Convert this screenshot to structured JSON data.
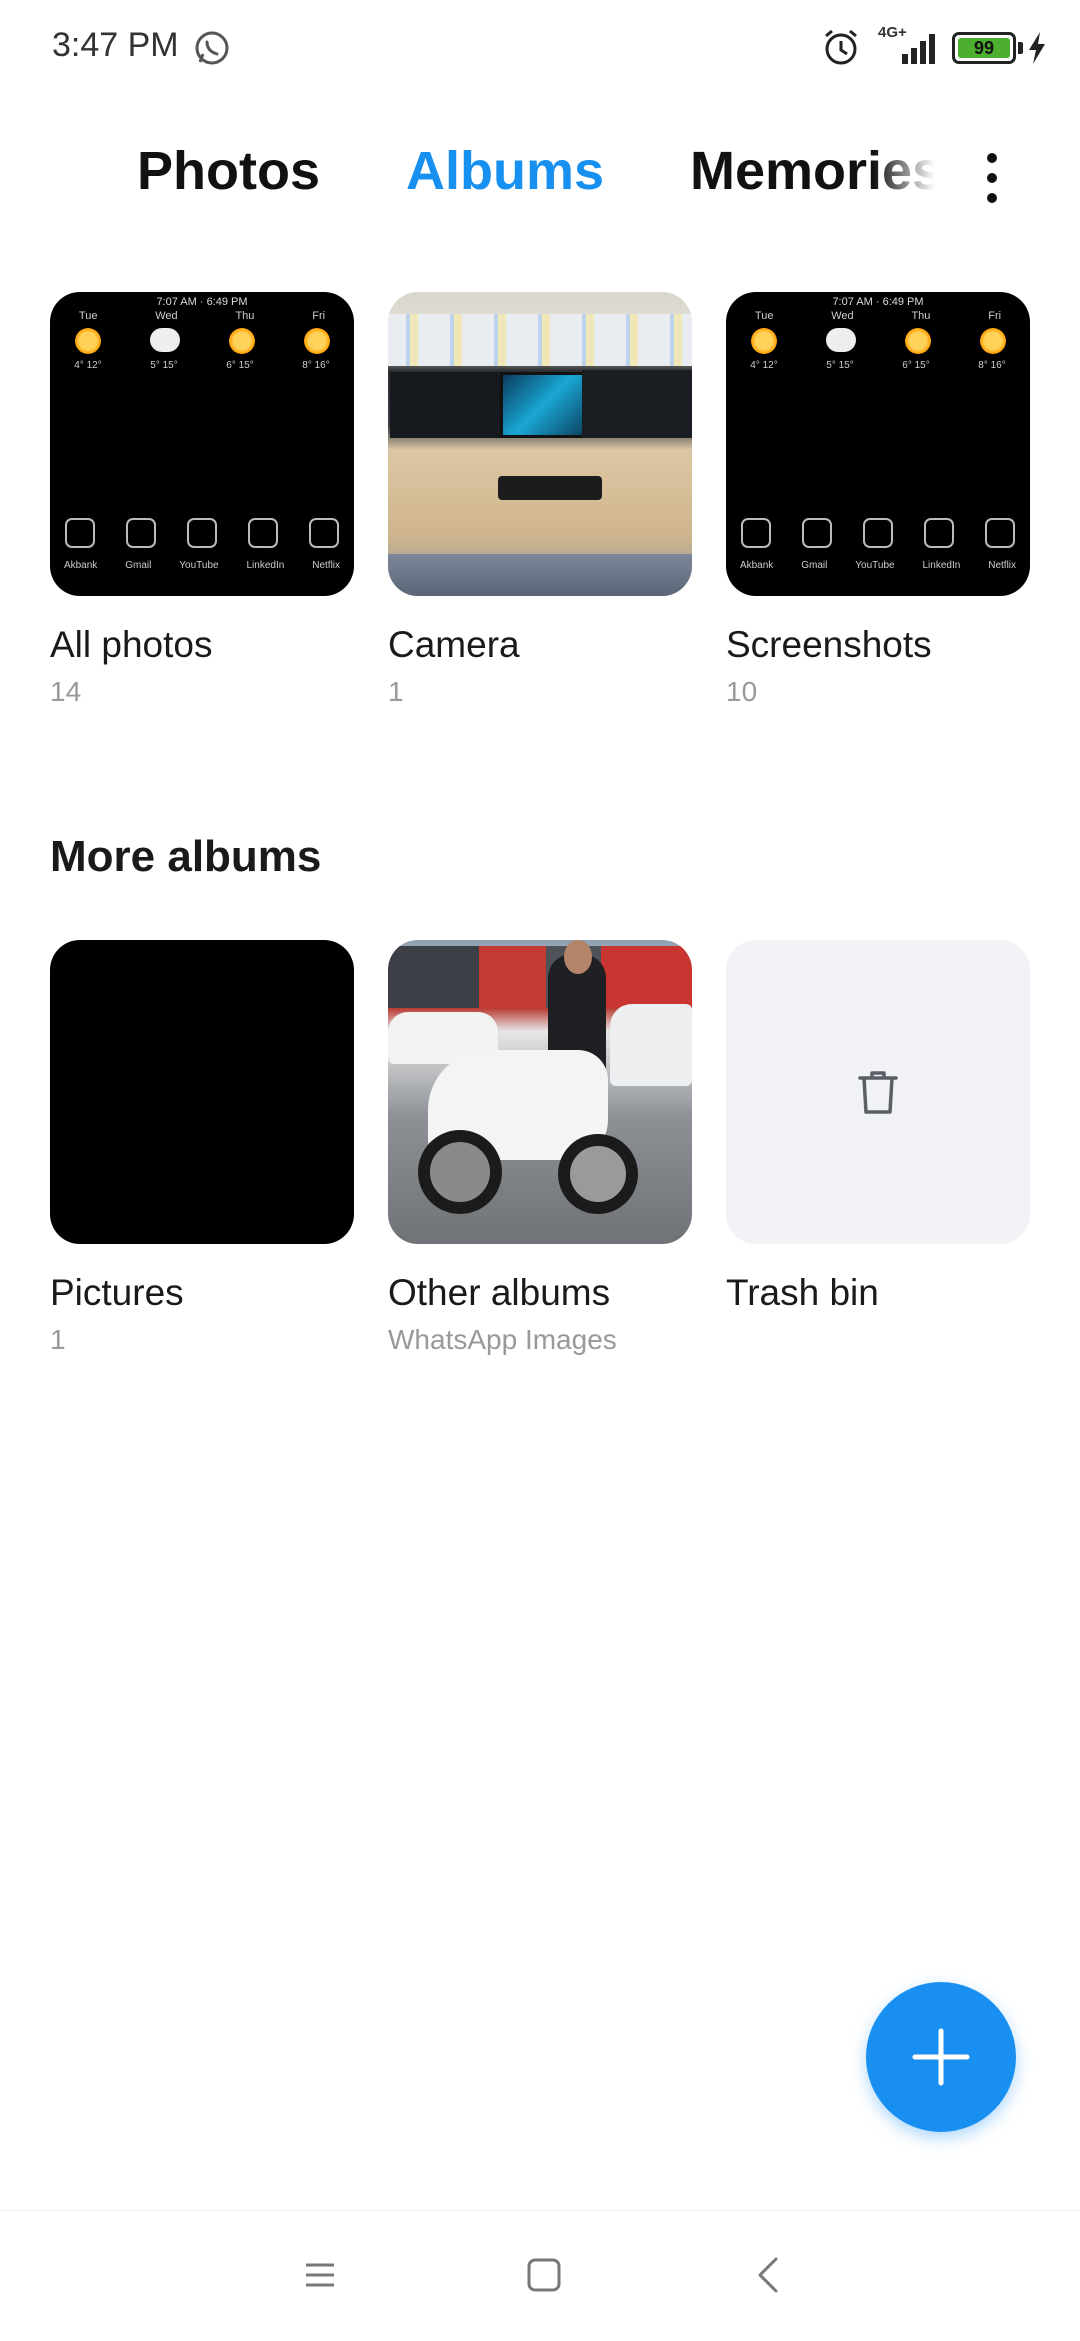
{
  "status_bar": {
    "time": "3:47 PM",
    "network": "4G+",
    "battery": "99"
  },
  "tabs": [
    {
      "label": "Photos",
      "active": false
    },
    {
      "label": "Albums",
      "active": true
    },
    {
      "label": "Memories",
      "active": false
    }
  ],
  "accent_color": "#1890f0",
  "albums": [
    {
      "name": "All photos",
      "count": "14"
    },
    {
      "name": "Camera",
      "count": "1"
    },
    {
      "name": "Screenshots",
      "count": "10"
    }
  ],
  "screenshot_preview": {
    "top_line": "7:07 AM  ·  6:49 PM",
    "days": [
      "Tue",
      "Wed",
      "Thu",
      "Fri"
    ],
    "temps": [
      "4° 12°",
      "5° 15°",
      "6° 15°",
      "8° 16°"
    ],
    "apps": [
      "Akbank",
      "Gmail",
      "YouTube",
      "LinkedIn",
      "Netflix"
    ]
  },
  "more_albums": {
    "title": "More albums",
    "items": [
      {
        "name": "Pictures",
        "count": "1"
      },
      {
        "name": "Other albums",
        "count": "WhatsApp Images"
      },
      {
        "name": "Trash bin",
        "count": ""
      }
    ]
  },
  "icons": {
    "fab": "plus-icon",
    "menu": "more-vertical-icon",
    "trash": "trash-icon",
    "nav": [
      "menu-lines-icon",
      "square-home-icon",
      "chevron-back-icon"
    ]
  }
}
